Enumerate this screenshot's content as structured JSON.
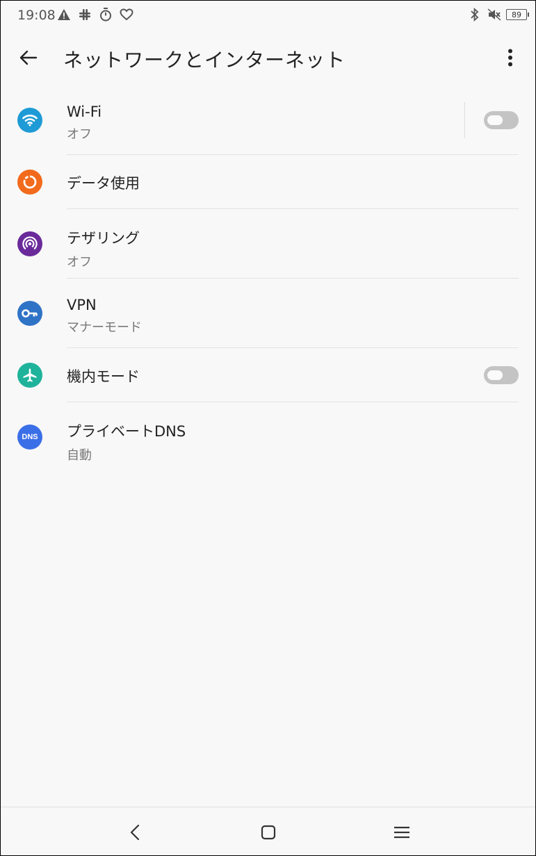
{
  "status_bar": {
    "time": "19:08",
    "left_icons": [
      "warning-icon",
      "slack-icon",
      "timer-icon",
      "heart-icon"
    ],
    "right_icons": [
      "bluetooth-icon",
      "mute-icon"
    ],
    "battery_level": "89"
  },
  "app_bar": {
    "title": "ネットワークとインターネット"
  },
  "settings": [
    {
      "title": "Wi-Fi",
      "subtitle": "オフ",
      "icon": "wifi-icon",
      "icon_color": "#1e9bd6",
      "toggle": false
    },
    {
      "title": "データ使用",
      "subtitle": "",
      "icon": "data-usage-icon",
      "icon_color": "#f26a1b"
    },
    {
      "title": "テザリング",
      "subtitle": "オフ",
      "icon": "hotspot-icon",
      "icon_color": "#6a2a9a"
    },
    {
      "title": "VPN",
      "subtitle": "マナーモード",
      "icon": "vpn-key-icon",
      "icon_color": "#2f73c6"
    },
    {
      "title": "機内モード",
      "subtitle": "",
      "icon": "airplane-icon",
      "icon_color": "#1fb39b",
      "toggle": false
    },
    {
      "title": "プライベートDNS",
      "subtitle": "自動",
      "icon": "dns-icon",
      "icon_color": "#3b6fe8",
      "icon_text": "DNS"
    }
  ],
  "nav_bar": {
    "buttons": [
      "back-nav-icon",
      "home-nav-icon",
      "recents-nav-icon"
    ]
  }
}
